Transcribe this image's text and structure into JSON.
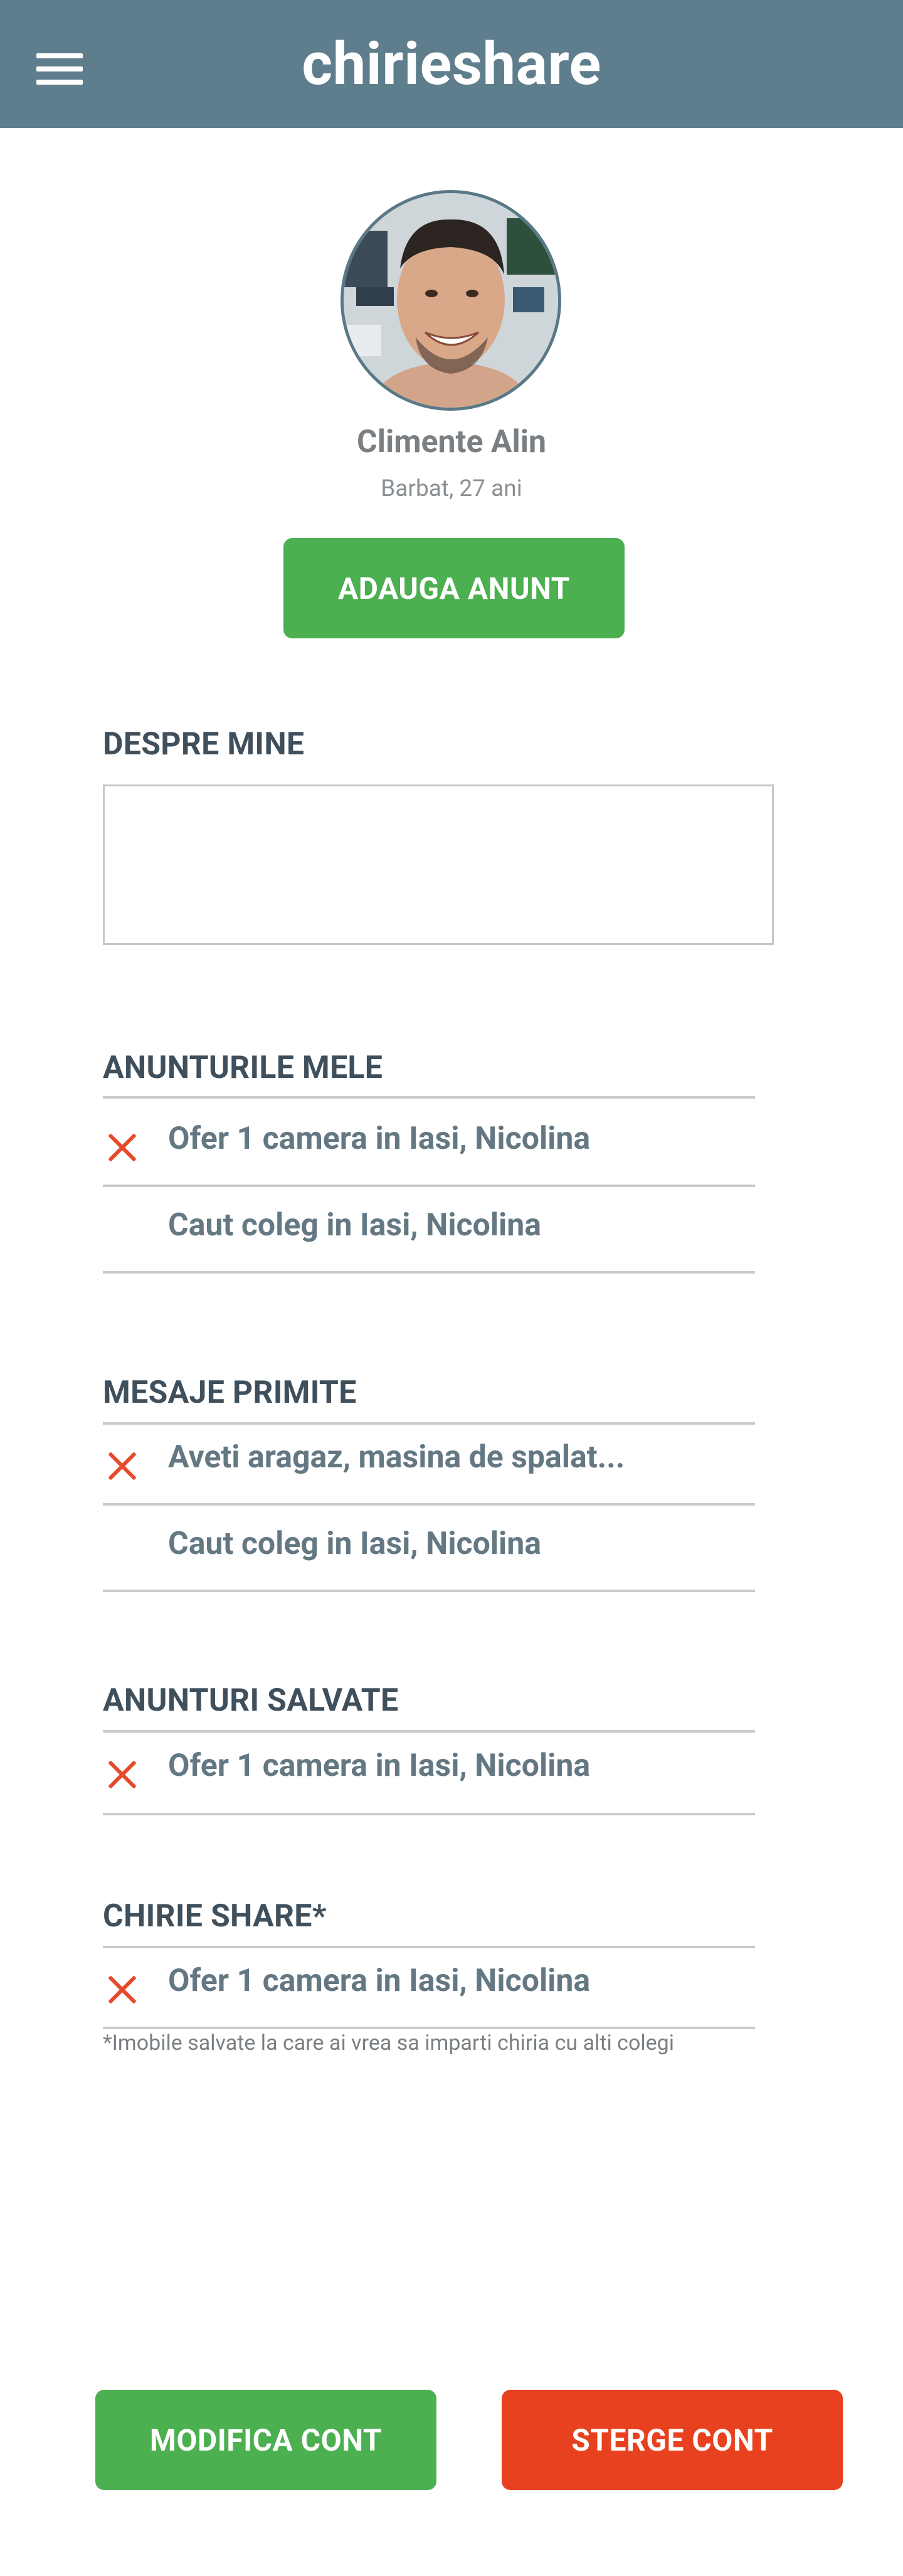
{
  "app": {
    "title": "chirieshare",
    "icons": {
      "menu": "hamburger-menu-icon",
      "delete": "close-x-icon"
    }
  },
  "colors": {
    "header": "#5f7e8d",
    "primary_button": "#4caf50",
    "danger_button": "#e8411f",
    "delete_icon": "#e64a2a",
    "item_text": "#647883",
    "section_title": "#3f4f5c"
  },
  "profile": {
    "name": "Climente Alin",
    "details": "Barbat, 27 ani",
    "add_button": "ADAUGA ANUNT"
  },
  "about": {
    "title": "DESPRE MINE",
    "value": ""
  },
  "my_listings": {
    "title": "ANUNTURILE MELE",
    "items": [
      {
        "label": "Ofer 1 camera in Iasi, Nicolina",
        "has_delete": true
      },
      {
        "label": "Caut coleg in Iasi, Nicolina",
        "has_delete": false
      }
    ]
  },
  "messages": {
    "title": "MESAJE PRIMITE",
    "items": [
      {
        "label": "Aveti aragaz, masina de spalat...",
        "has_delete": true
      },
      {
        "label": "Caut coleg in Iasi, Nicolina",
        "has_delete": false
      }
    ]
  },
  "saved": {
    "title": "ANUNTURI SALVATE",
    "items": [
      {
        "label": "Ofer 1 camera in Iasi, Nicolina",
        "has_delete": true
      }
    ]
  },
  "share": {
    "title": "CHIRIE SHARE*",
    "items": [
      {
        "label": "Ofer 1 camera in Iasi, Nicolina",
        "has_delete": true
      }
    ],
    "note": "*Imobile salvate la care ai vrea sa imparti chiria cu alti colegi"
  },
  "actions": {
    "edit_button": "MODIFICA CONT",
    "delete_button": "STERGE CONT"
  }
}
